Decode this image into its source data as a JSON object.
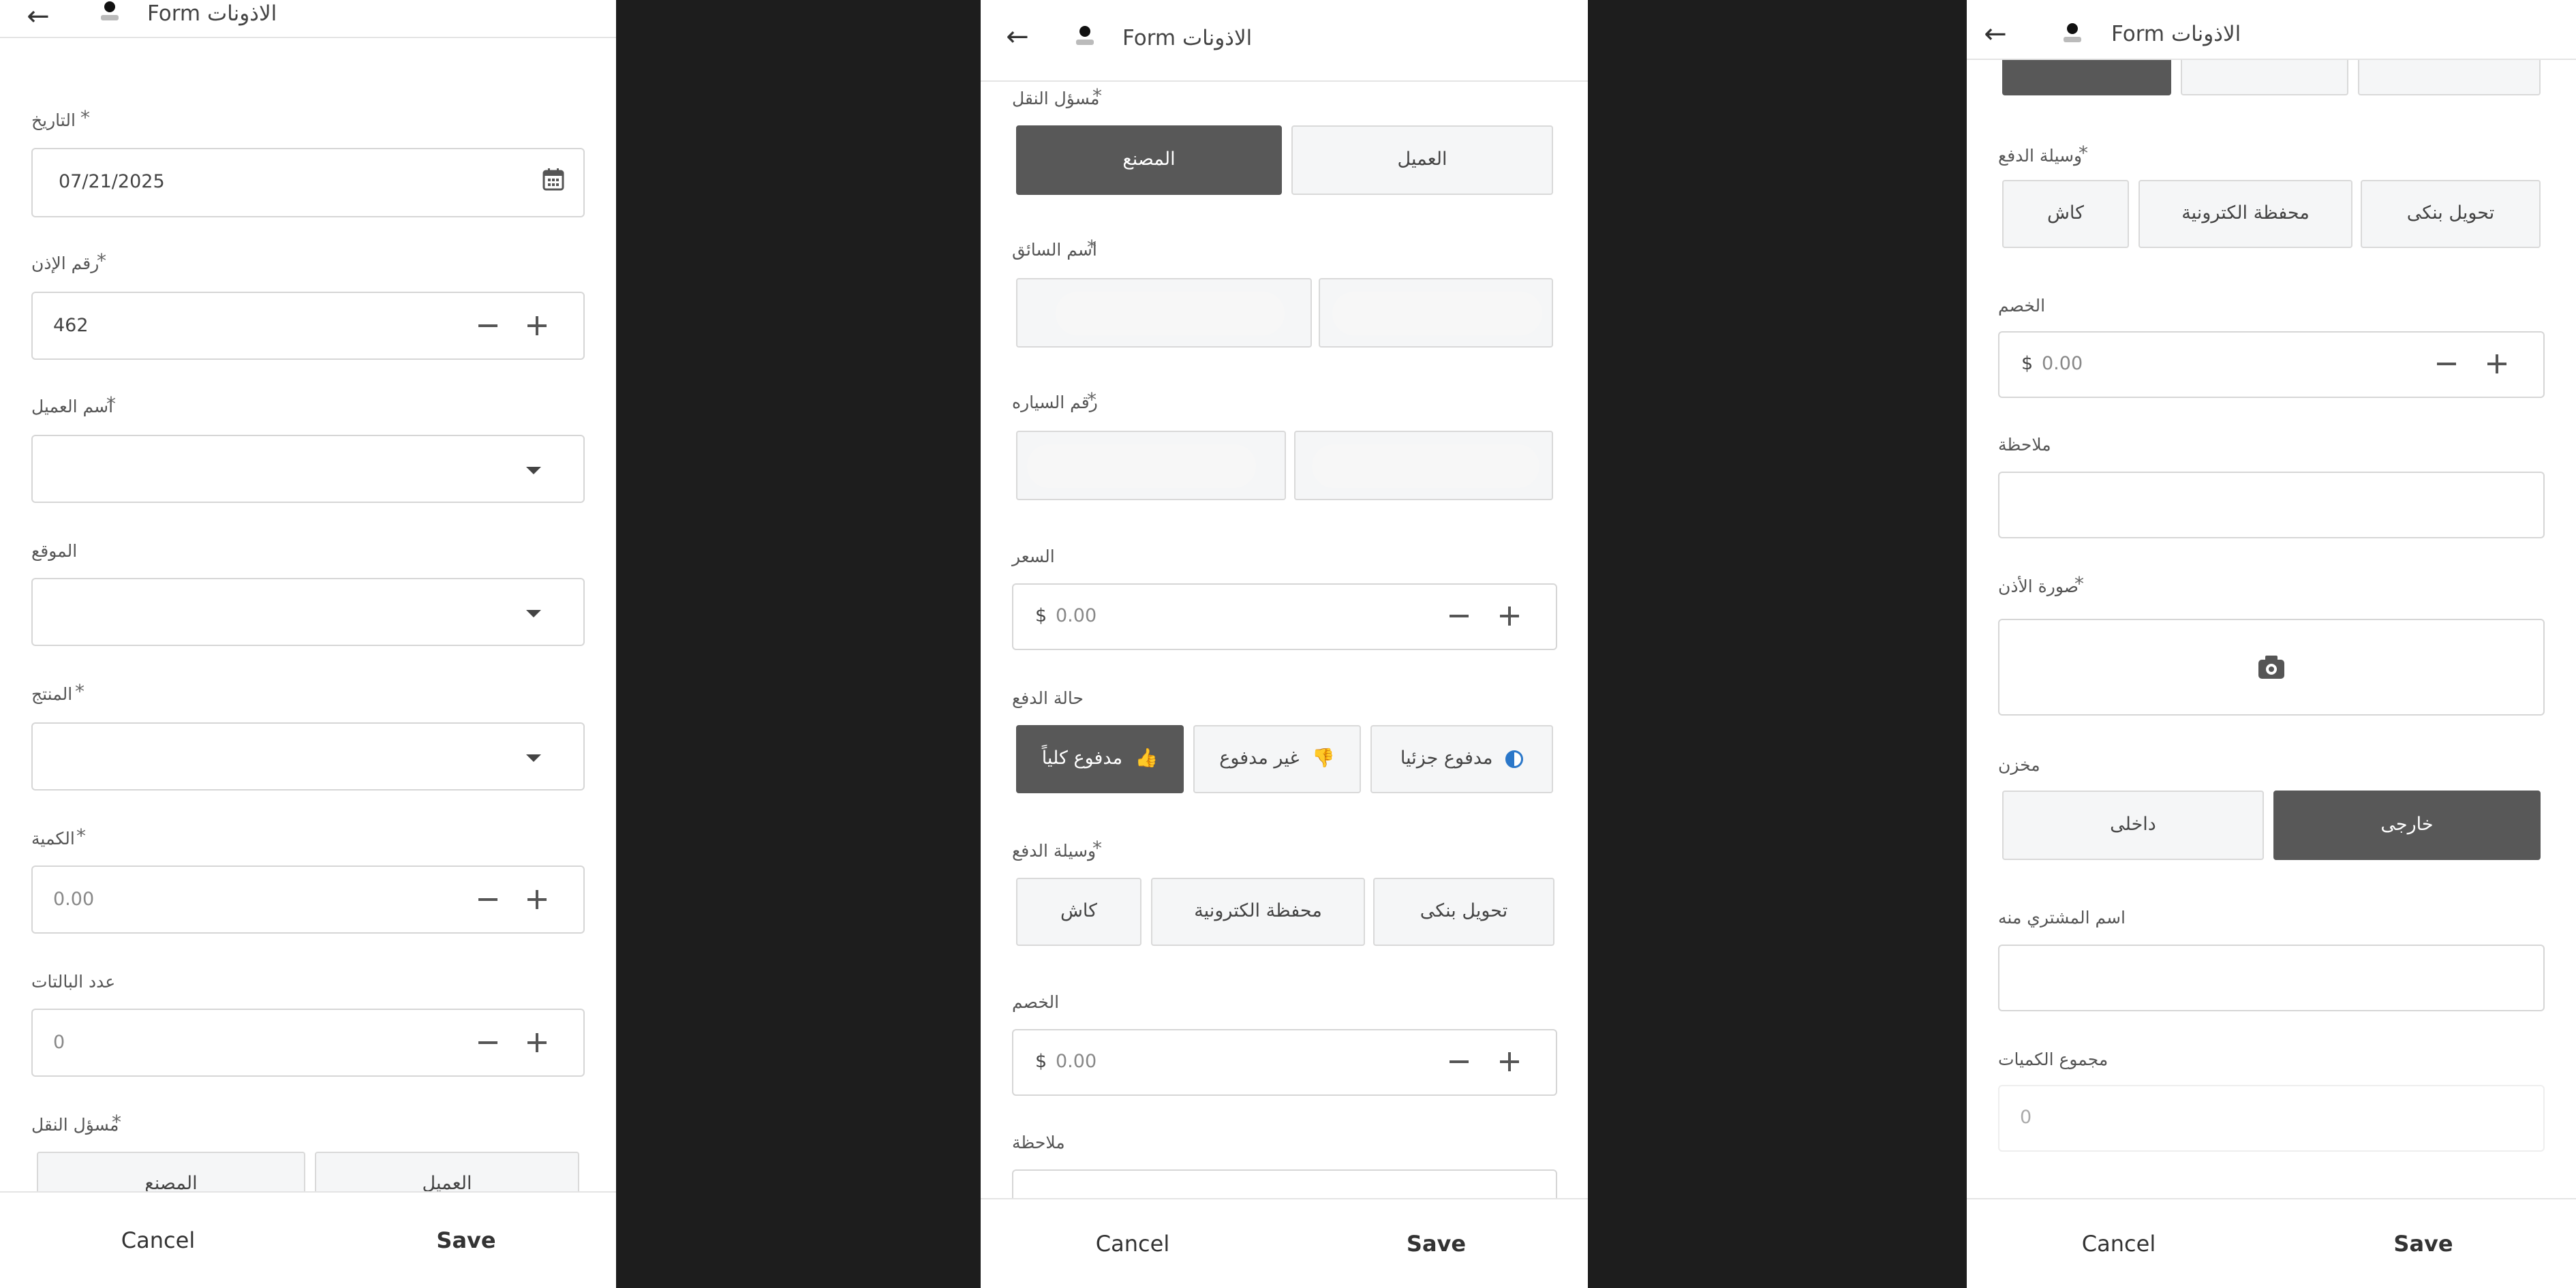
{
  "header": {
    "title": "Form الاذونات"
  },
  "footer": {
    "cancel": "Cancel",
    "save": "Save"
  },
  "fields": {
    "date": {
      "label": "التاريخ",
      "value": "07/21/2025"
    },
    "permit_no": {
      "label": "رقم الإذن",
      "value": "462"
    },
    "customer": {
      "label": "اسم العميل",
      "value": ""
    },
    "location": {
      "label": "الموقع",
      "value": ""
    },
    "product": {
      "label": "المنتج",
      "value": ""
    },
    "quantity": {
      "label": "الكمية",
      "value": "0.00"
    },
    "pallets": {
      "label": "عدد البالتات",
      "value": "0"
    },
    "transport": {
      "label": "مسؤل النقل",
      "options": [
        "العميل",
        "المصنع"
      ],
      "selected": "المصنع"
    },
    "driver": {
      "label": "اسم السائق"
    },
    "car_no": {
      "label": "رقم السياره"
    },
    "price": {
      "label": "السعر",
      "currency": "$",
      "value": "0.00"
    },
    "payment_status": {
      "label": "حالة الدفع",
      "options": [
        "مدفوع جزئيا",
        "غير مدفوع",
        "مدفوع كلياً"
      ],
      "selected": "مدفوع كلياً"
    },
    "payment_method": {
      "label": "وسيلة الدفع",
      "options": [
        "تحويل بنكى",
        "محفظة الكترونية",
        "كاش"
      ]
    },
    "discount": {
      "label": "الخصم",
      "currency": "$",
      "value": "0.00"
    },
    "note": {
      "label": "ملاحظة",
      "value": ""
    },
    "permit_image": {
      "label": "صورة الأذن"
    },
    "warehouse": {
      "label": "مخزن",
      "options": [
        "داخلى",
        "خارجى"
      ],
      "selected": "خارجى"
    },
    "buyer_name": {
      "label": "اسم المشتري منه",
      "value": ""
    },
    "total_qty": {
      "label": "مجموع الكميات",
      "value": "0"
    }
  },
  "colors": {
    "active": "#585858",
    "green": "#2aa52a",
    "red": "#cc1f1f",
    "blue": "#2a77c9"
  },
  "icons": [
    "back-arrow-icon",
    "calendar-icon",
    "minus-icon",
    "plus-icon",
    "chevron-down-icon",
    "thumbs-up-icon",
    "thumbs-down-icon",
    "half-circle-icon",
    "camera-icon"
  ]
}
